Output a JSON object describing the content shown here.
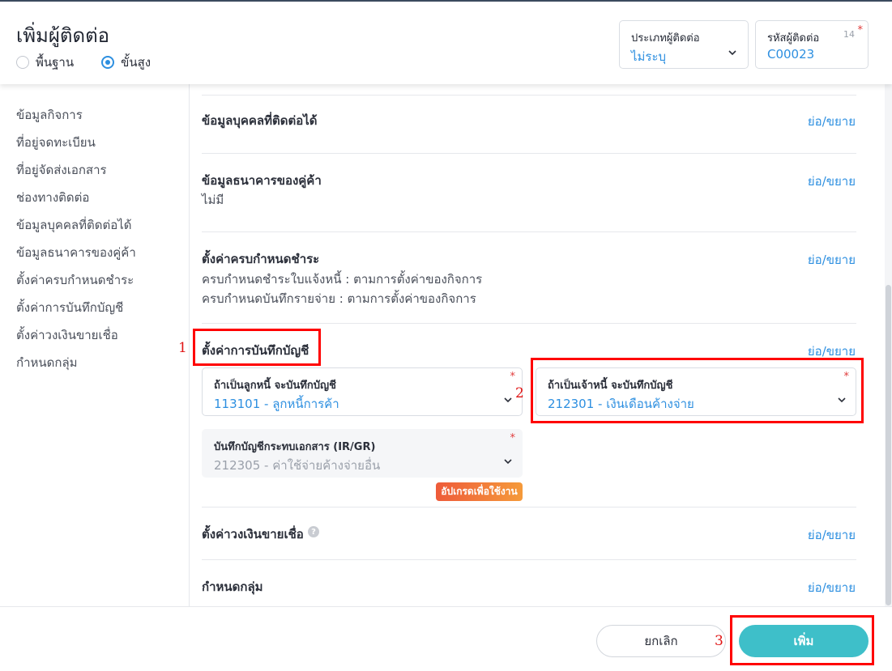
{
  "header": {
    "title": "เพิ่มผู้ติดต่อ",
    "mode_options": [
      {
        "label": "พื้นฐาน",
        "selected": false
      },
      {
        "label": "ขั้นสูง",
        "selected": true
      }
    ],
    "contact_type": {
      "label": "ประเภทผู้ติดต่อ",
      "value": "ไม่ระบุ"
    },
    "contact_code": {
      "label": "รหัสผู้ติดต่อ",
      "value": "C00023",
      "char_count": "14",
      "required_mark": "*"
    }
  },
  "sidebar": {
    "items": [
      {
        "label": "ข้อมูลกิจการ"
      },
      {
        "label": "ที่อยู่จดทะเบียน"
      },
      {
        "label": "ที่อยู่จัดส่งเอกสาร"
      },
      {
        "label": "ช่องทางติดต่อ"
      },
      {
        "label": "ข้อมูลบุคคลที่ติดต่อได้"
      },
      {
        "label": "ข้อมูลธนาคารของคู่ค้า"
      },
      {
        "label": "ตั้งค่าครบกำหนดชำระ"
      },
      {
        "label": "ตั้งค่าการบันทึกบัญชี"
      },
      {
        "label": "ตั้งค่าวงเงินขายเชื่อ"
      },
      {
        "label": "กำหนดกลุ่ม"
      }
    ]
  },
  "sections": {
    "toggle_label": "ย่อ/ขยาย",
    "contact_persons": {
      "title": "ข้อมูลบุคคลที่ติดต่อได้"
    },
    "bank": {
      "title": "ข้อมูลธนาคารของคู่ค้า",
      "value": "ไม่มี"
    },
    "due": {
      "title": "ตั้งค่าครบกำหนดชำระ",
      "line1": "ครบกำหนดชำระใบแจ้งหนี้ : ตามการตั้งค่าของกิจการ",
      "line2": "ครบกำหนดบันทึกรายจ่าย : ตามการตั้งค่าของกิจการ"
    },
    "accounting": {
      "title": "ตั้งค่าการบันทึกบัญชี",
      "receivable": {
        "label": "ถ้าเป็นลูกหนี้ จะบันทึกบัญชี",
        "value": "113101 - ลูกหนี้การค้า",
        "required_mark": "*"
      },
      "payable": {
        "label": "ถ้าเป็นเจ้าหนี้ จะบันทึกบัญชี",
        "value": "212301 - เงินเดือนค้างจ่าย",
        "required_mark": "*"
      },
      "irgr": {
        "label": "บันทึกบัญชีกระทบเอกสาร (IR/GR)",
        "value": "212305 - ค่าใช้จ่ายค้างจ่ายอื่น",
        "required_mark": "*"
      },
      "upgrade_badge": "อัปเกรดเพื่อใช้งาน"
    },
    "credit": {
      "title": "ตั้งค่าวงเงินขายเชื่อ",
      "help": "?"
    },
    "group": {
      "title": "กำหนดกลุ่ม"
    }
  },
  "annotations": [
    "1",
    "2",
    "3"
  ],
  "footer": {
    "cancel_label": "ยกเลิก",
    "add_label": "เพิ่ม"
  },
  "colors": {
    "accent": "#2d8fe0",
    "primary_button": "#3ebfc9",
    "annotation": "#ff0000",
    "required": "#e03b3b"
  }
}
